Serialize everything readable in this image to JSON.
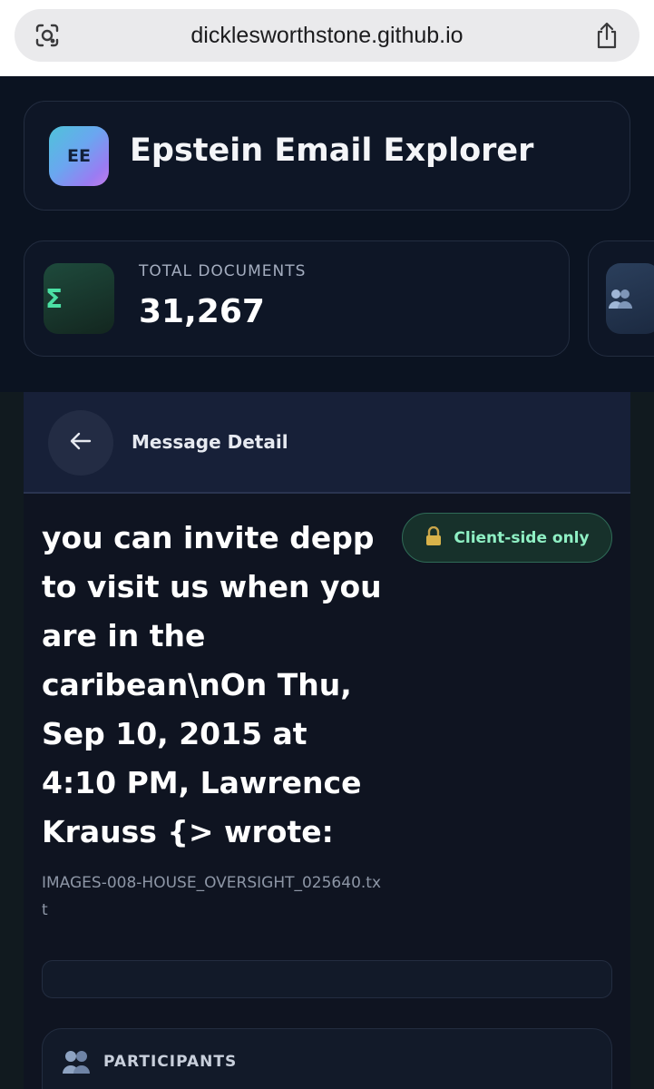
{
  "browser": {
    "url": "dicklesworthstone.github.io",
    "reader_icon": "reader-mode-icon",
    "share_icon": "share-icon"
  },
  "app": {
    "logo_text": "EE",
    "title": "Epstein Email Explorer"
  },
  "stats": [
    {
      "icon": "sigma-icon",
      "glyph": "Σ",
      "label": "TOTAL DOCUMENTS",
      "value": "31,267"
    },
    {
      "icon": "people-icon"
    }
  ],
  "detail": {
    "back_icon": "back-arrow-icon",
    "title": "Message Detail",
    "subject": "you can invite depp to visit us when you are in the caribean\\nOn Thu, Sep 10, 2015 at 4:10 PM, Lawrence Krauss {> wrote:",
    "badge": {
      "icon": "lock-icon",
      "label": "Client-side only"
    },
    "filename": "IMAGES-008-HOUSE_OVERSIGHT_025640.txt",
    "participants": {
      "icon": "people-icon",
      "label": "PARTICIPANTS"
    }
  },
  "colors": {
    "background": "#0c1423",
    "accent_green": "#8ff0c4",
    "card_border": "#232d40"
  }
}
